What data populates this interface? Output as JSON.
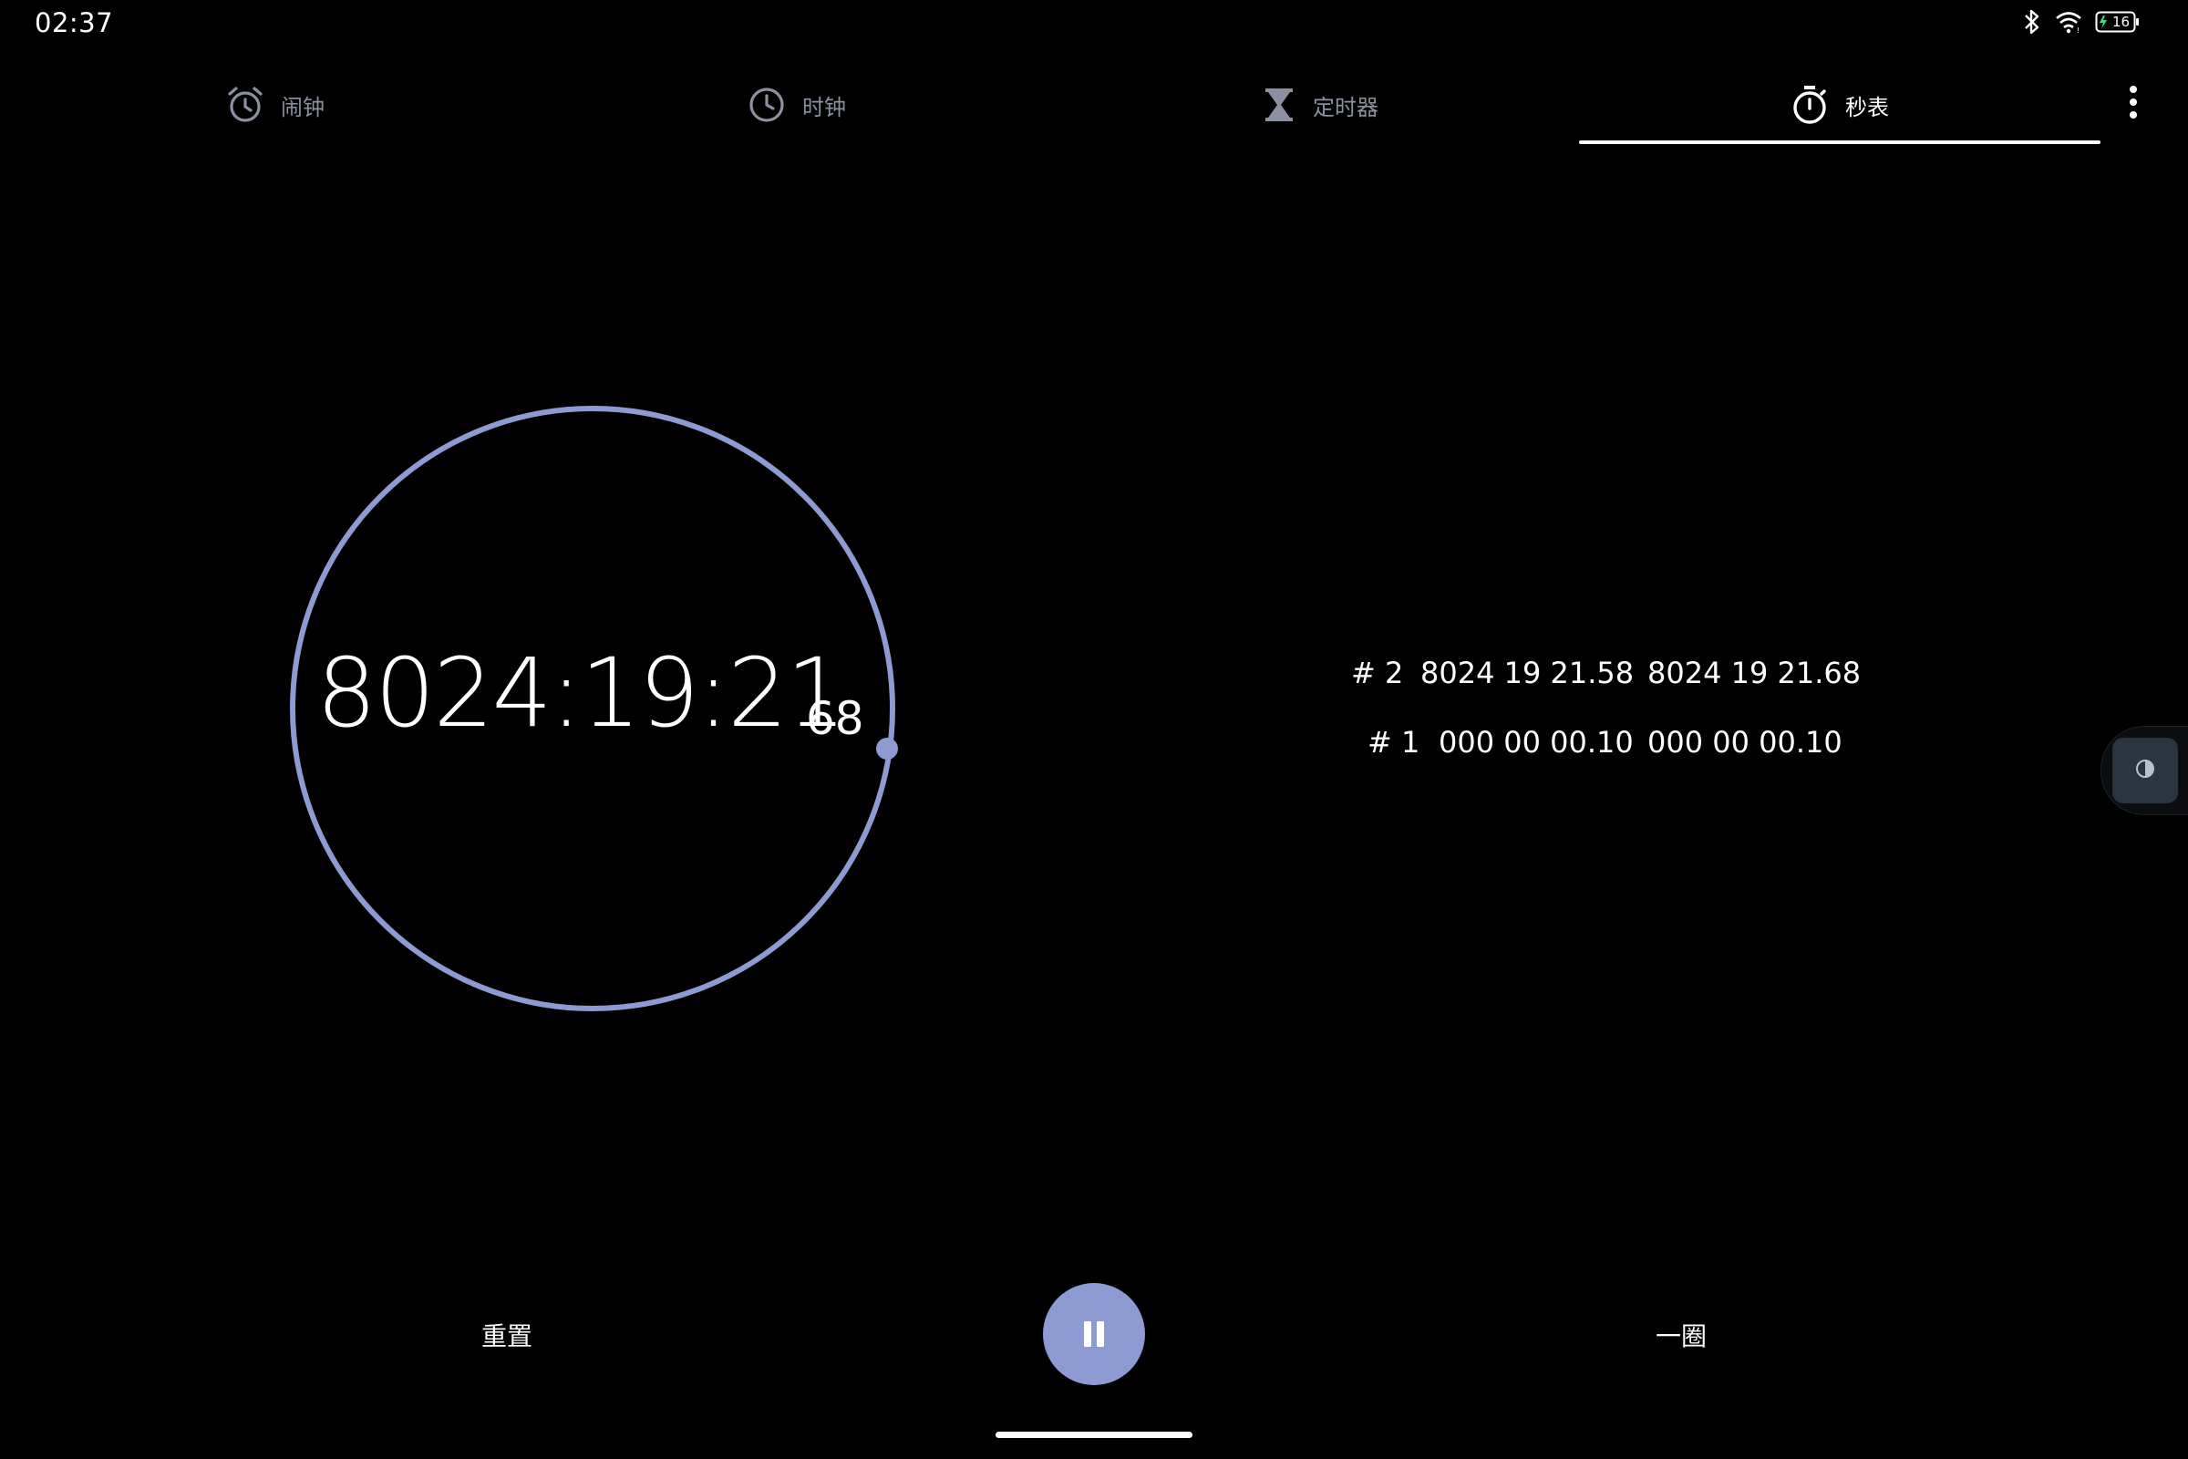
{
  "status_bar": {
    "time": "02:37",
    "battery_level": "16",
    "icons": [
      "bluetooth-icon",
      "wifi-icon",
      "battery-charging-icon"
    ]
  },
  "tabs": [
    {
      "label": "闹钟",
      "icon": "alarm-icon",
      "active": false
    },
    {
      "label": "时钟",
      "icon": "clock-icon",
      "active": false
    },
    {
      "label": "定时器",
      "icon": "hourglass-icon",
      "active": false
    },
    {
      "label": "秒表",
      "icon": "stopwatch-icon",
      "active": true
    }
  ],
  "stopwatch": {
    "elapsed": "8024:19:21",
    "hundredths": "68"
  },
  "laps": [
    {
      "number": "# 2",
      "lap_time": "8024 19 21.58",
      "total_time": "8024 19 21.68"
    },
    {
      "number": "# 1",
      "lap_time": "000 00 00.10",
      "total_time": "000 00 00.10"
    }
  ],
  "controls": {
    "reset_label": "重置",
    "lap_label": "一圈"
  },
  "colors": {
    "accent": "#8e9ad2",
    "background": "#000000",
    "inactive_tab": "#8c90a0"
  }
}
